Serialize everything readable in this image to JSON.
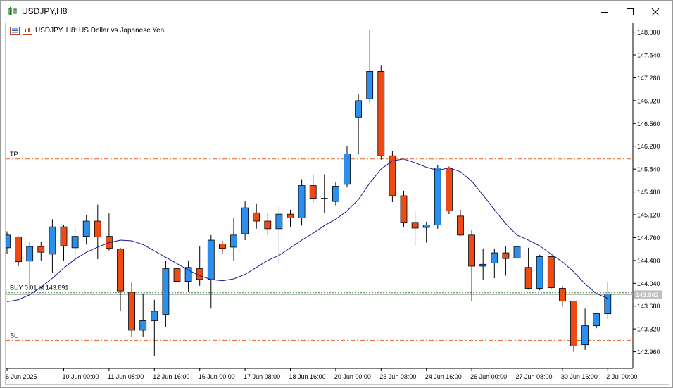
{
  "window": {
    "title": "USDJPY,H8",
    "controls": [
      "minimize",
      "maximize",
      "close"
    ]
  },
  "chart_header": {
    "text": "USDJPY, H8:  US Dollar vs Japanese Yen"
  },
  "levels": {
    "tp": {
      "label": "TP",
      "price": 146.0,
      "color": "#e8622b"
    },
    "sl": {
      "label": "SL",
      "price": 143.14,
      "color": "#e8622b"
    },
    "buy": {
      "label": "BUY 0.01 at 143.891",
      "price": 143.891,
      "color": "#3a8a3a"
    },
    "current": {
      "label": "143.862",
      "price": 143.862
    }
  },
  "colors": {
    "bull": "#2b8ff0",
    "bear": "#f04a14",
    "ma": "#1a1a8c",
    "grid": "#ffffff",
    "axis": "#000000"
  },
  "chart_data": {
    "type": "candlestick",
    "symbol": "USDJPY",
    "timeframe": "H8",
    "y_ticks": [
      "148.000",
      "147.640",
      "147.280",
      "146.920",
      "146.560",
      "146.200",
      "145.840",
      "145.480",
      "145.120",
      "144.760",
      "144.400",
      "144.040",
      "143.680",
      "143.320",
      "142.960"
    ],
    "ylim": [
      142.7,
      148.14
    ],
    "x_ticks": [
      {
        "label": "6 Jun 2025",
        "index": 0
      },
      {
        "label": "10 Jun 00:00",
        "index": 5
      },
      {
        "label": "11 Jun 08:00",
        "index": 9
      },
      {
        "label": "12 Jun 16:00",
        "index": 13
      },
      {
        "label": "16 Jun 00:00",
        "index": 17
      },
      {
        "label": "17 Jun 08:00",
        "index": 21
      },
      {
        "label": "18 Jun 16:00",
        "index": 25
      },
      {
        "label": "20 Jun 00:00",
        "index": 29
      },
      {
        "label": "23 Jun 08:00",
        "index": 33
      },
      {
        "label": "24 Jun 16:00",
        "index": 37
      },
      {
        "label": "26 Jun 00:00",
        "index": 41
      },
      {
        "label": "27 Jun 08:00",
        "index": 45
      },
      {
        "label": "30 Jun 16:00",
        "index": 49
      },
      {
        "label": "2 Jul 00:00",
        "index": 53
      }
    ],
    "candles": [
      {
        "o": 144.6,
        "h": 144.86,
        "l": 144.5,
        "c": 144.8
      },
      {
        "o": 144.77,
        "h": 144.78,
        "l": 144.31,
        "c": 144.38
      },
      {
        "o": 144.39,
        "h": 144.7,
        "l": 143.95,
        "c": 144.62
      },
      {
        "o": 144.62,
        "h": 144.7,
        "l": 144.4,
        "c": 144.53
      },
      {
        "o": 144.5,
        "h": 145.05,
        "l": 144.2,
        "c": 144.93
      },
      {
        "o": 144.93,
        "h": 144.96,
        "l": 144.4,
        "c": 144.63
      },
      {
        "o": 144.6,
        "h": 144.93,
        "l": 144.4,
        "c": 144.78
      },
      {
        "o": 144.78,
        "h": 145.12,
        "l": 144.65,
        "c": 145.02
      },
      {
        "o": 145.02,
        "h": 145.28,
        "l": 144.42,
        "c": 144.77
      },
      {
        "o": 144.78,
        "h": 145.14,
        "l": 144.56,
        "c": 144.59
      },
      {
        "o": 144.58,
        "h": 144.6,
        "l": 143.6,
        "c": 143.92
      },
      {
        "o": 143.9,
        "h": 144.05,
        "l": 143.2,
        "c": 143.3
      },
      {
        "o": 143.3,
        "h": 143.88,
        "l": 143.2,
        "c": 143.45
      },
      {
        "o": 143.45,
        "h": 143.78,
        "l": 142.9,
        "c": 143.6
      },
      {
        "o": 143.55,
        "h": 144.4,
        "l": 143.35,
        "c": 144.27
      },
      {
        "o": 144.27,
        "h": 144.38,
        "l": 144.0,
        "c": 144.07
      },
      {
        "o": 144.07,
        "h": 144.4,
        "l": 143.9,
        "c": 144.29
      },
      {
        "o": 144.27,
        "h": 144.62,
        "l": 144.0,
        "c": 144.1
      },
      {
        "o": 144.1,
        "h": 144.8,
        "l": 143.64,
        "c": 144.72
      },
      {
        "o": 144.66,
        "h": 144.71,
        "l": 144.5,
        "c": 144.59
      },
      {
        "o": 144.61,
        "h": 145.07,
        "l": 144.4,
        "c": 144.8
      },
      {
        "o": 144.82,
        "h": 145.33,
        "l": 144.72,
        "c": 145.23
      },
      {
        "o": 145.15,
        "h": 145.3,
        "l": 144.9,
        "c": 145.02
      },
      {
        "o": 145.02,
        "h": 145.15,
        "l": 144.8,
        "c": 144.9
      },
      {
        "o": 144.9,
        "h": 145.25,
        "l": 144.35,
        "c": 145.13
      },
      {
        "o": 145.13,
        "h": 145.2,
        "l": 144.92,
        "c": 145.07
      },
      {
        "o": 145.07,
        "h": 145.68,
        "l": 144.95,
        "c": 145.58
      },
      {
        "o": 145.58,
        "h": 145.76,
        "l": 145.31,
        "c": 145.38
      },
      {
        "o": 145.38,
        "h": 145.76,
        "l": 145.15,
        "c": 145.38
      },
      {
        "o": 145.33,
        "h": 145.63,
        "l": 145.27,
        "c": 145.57
      },
      {
        "o": 145.6,
        "h": 146.2,
        "l": 145.55,
        "c": 146.08
      },
      {
        "o": 146.66,
        "h": 147.02,
        "l": 146.08,
        "c": 146.92
      },
      {
        "o": 146.95,
        "h": 148.03,
        "l": 146.88,
        "c": 147.38
      },
      {
        "o": 147.38,
        "h": 147.47,
        "l": 145.99,
        "c": 146.05
      },
      {
        "o": 146.05,
        "h": 146.12,
        "l": 145.32,
        "c": 145.42
      },
      {
        "o": 145.42,
        "h": 145.5,
        "l": 144.92,
        "c": 145.0
      },
      {
        "o": 145.0,
        "h": 145.18,
        "l": 144.63,
        "c": 144.91
      },
      {
        "o": 144.92,
        "h": 145.01,
        "l": 144.68,
        "c": 144.96
      },
      {
        "o": 144.96,
        "h": 145.9,
        "l": 144.9,
        "c": 145.86
      },
      {
        "o": 145.86,
        "h": 145.88,
        "l": 145.13,
        "c": 145.18
      },
      {
        "o": 145.1,
        "h": 145.2,
        "l": 144.79,
        "c": 144.8
      },
      {
        "o": 144.8,
        "h": 144.88,
        "l": 143.76,
        "c": 144.31
      },
      {
        "o": 144.31,
        "h": 144.59,
        "l": 144.09,
        "c": 144.34
      },
      {
        "o": 144.36,
        "h": 144.59,
        "l": 144.12,
        "c": 144.52
      },
      {
        "o": 144.52,
        "h": 144.62,
        "l": 144.16,
        "c": 144.43
      },
      {
        "o": 144.44,
        "h": 144.95,
        "l": 144.28,
        "c": 144.62
      },
      {
        "o": 144.29,
        "h": 144.6,
        "l": 143.94,
        "c": 143.96
      },
      {
        "o": 143.96,
        "h": 144.49,
        "l": 143.93,
        "c": 144.46
      },
      {
        "o": 144.46,
        "h": 144.48,
        "l": 143.94,
        "c": 143.97
      },
      {
        "o": 143.96,
        "h": 144.0,
        "l": 143.67,
        "c": 143.76
      },
      {
        "o": 143.76,
        "h": 143.76,
        "l": 142.96,
        "c": 143.05
      },
      {
        "o": 143.07,
        "h": 143.64,
        "l": 142.99,
        "c": 143.37
      },
      {
        "o": 143.37,
        "h": 143.56,
        "l": 143.33,
        "c": 143.56
      },
      {
        "o": 143.56,
        "h": 144.07,
        "l": 143.48,
        "c": 143.87
      }
    ],
    "ma": [
      143.75,
      143.78,
      143.86,
      143.98,
      144.12,
      144.28,
      144.42,
      144.53,
      144.61,
      144.68,
      144.72,
      144.71,
      144.65,
      144.55,
      144.45,
      144.35,
      144.25,
      144.16,
      144.1,
      144.08,
      144.11,
      144.18,
      144.29,
      144.4,
      144.48,
      144.6,
      144.72,
      144.83,
      144.95,
      145.05,
      145.18,
      145.36,
      145.62,
      145.84,
      145.97,
      146.0,
      145.94,
      145.87,
      145.82,
      145.86,
      145.8,
      145.65,
      145.43,
      145.2,
      144.98,
      144.8,
      144.72,
      144.63,
      144.5,
      144.38,
      144.22,
      144.03,
      143.88,
      143.8
    ]
  }
}
